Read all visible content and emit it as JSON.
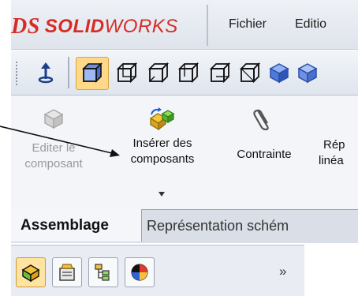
{
  "app": {
    "logo_mark": "DS",
    "logo_text_bold": "SOLID",
    "logo_text_light": "WORKS"
  },
  "menu": {
    "items": [
      "Fichier",
      "Editio"
    ]
  },
  "toolbar": {
    "icons": [
      "normal-to-icon",
      "view-front-icon",
      "view-back-icon",
      "view-left-icon",
      "view-right-icon",
      "view-top-icon",
      "isometric-icon",
      "cube-icon"
    ]
  },
  "commands": [
    {
      "label_line1": "Editer le",
      "label_line2": "composant",
      "enabled": false
    },
    {
      "label_line1": "Insérer des",
      "label_line2": "composants",
      "enabled": true
    },
    {
      "label_line1": "Contrainte",
      "label_line2": "",
      "enabled": true
    },
    {
      "label_line1": "Rép",
      "label_line2": "linéa",
      "enabled": true
    }
  ],
  "tabs": {
    "active": "Assemblage",
    "other": "Représentation schém"
  },
  "panel": {
    "chevron": "»"
  },
  "colors": {
    "logo_red": "#d62c26",
    "highlight": "#ffd889"
  }
}
